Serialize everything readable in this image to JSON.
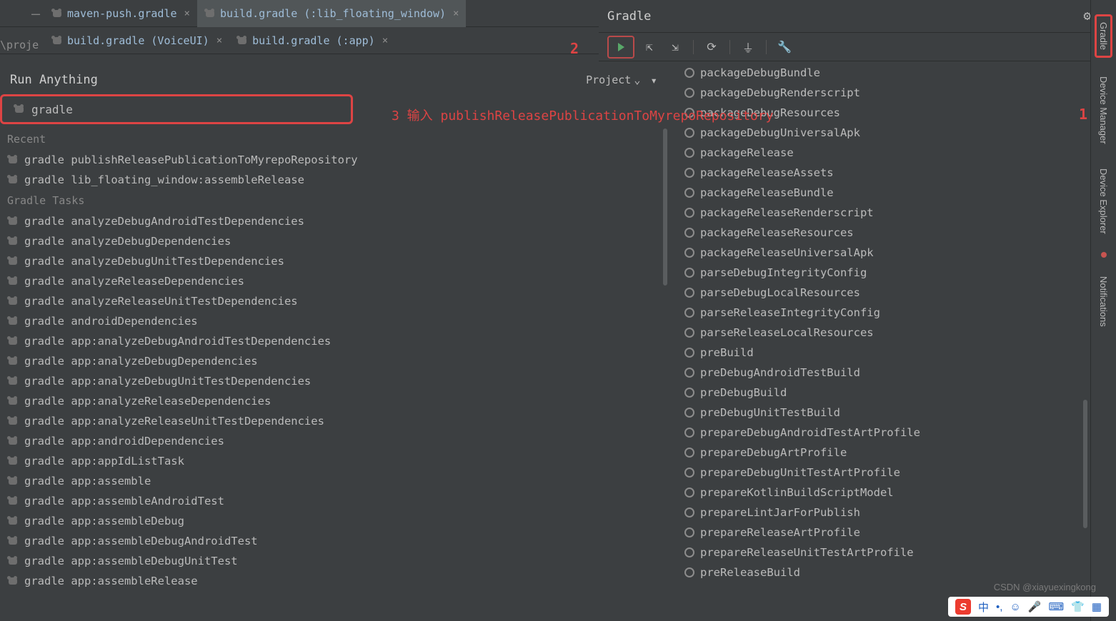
{
  "tabs_row1": [
    {
      "label": "maven-push.gradle",
      "active": false
    },
    {
      "label": "build.gradle (:lib_floating_window)",
      "active": true
    }
  ],
  "tabs_row2": [
    {
      "label": "build.gradle (VoiceUI)",
      "active": false
    },
    {
      "label": "build.gradle (:app)",
      "active": false
    }
  ],
  "breadcrumb_prefix": "\\proje",
  "gradle_panel": {
    "title": "Gradle",
    "toolbar": [
      "run",
      "expand",
      "collapse",
      "refresh",
      "offline",
      "settings"
    ]
  },
  "run_anything": {
    "title": "Run Anything",
    "scope_label": "Project",
    "input_value": "gradle",
    "sections": {
      "recent_label": "Recent",
      "recent": [
        "gradle publishReleasePublicationToMyrepoRepository",
        "gradle lib_floating_window:assembleRelease"
      ],
      "tasks_label": "Gradle Tasks",
      "tasks": [
        "gradle analyzeDebugAndroidTestDependencies",
        "gradle analyzeDebugDependencies",
        "gradle analyzeDebugUnitTestDependencies",
        "gradle analyzeReleaseDependencies",
        "gradle analyzeReleaseUnitTestDependencies",
        "gradle androidDependencies",
        "gradle app:analyzeDebugAndroidTestDependencies",
        "gradle app:analyzeDebugDependencies",
        "gradle app:analyzeDebugUnitTestDependencies",
        "gradle app:analyzeReleaseDependencies",
        "gradle app:analyzeReleaseUnitTestDependencies",
        "gradle app:androidDependencies",
        "gradle app:appIdListTask",
        "gradle app:assemble",
        "gradle app:assembleAndroidTest",
        "gradle app:assembleDebug",
        "gradle app:assembleDebugAndroidTest",
        "gradle app:assembleDebugUnitTest",
        "gradle app:assembleRelease"
      ]
    }
  },
  "gradle_tasks": [
    "packageDebugBundle",
    "packageDebugRenderscript",
    "packageDebugResources",
    "packageDebugUniversalApk",
    "packageRelease",
    "packageReleaseAssets",
    "packageReleaseBundle",
    "packageReleaseRenderscript",
    "packageReleaseResources",
    "packageReleaseUniversalApk",
    "parseDebugIntegrityConfig",
    "parseDebugLocalResources",
    "parseReleaseIntegrityConfig",
    "parseReleaseLocalResources",
    "preBuild",
    "preDebugAndroidTestBuild",
    "preDebugBuild",
    "preDebugUnitTestBuild",
    "prepareDebugAndroidTestArtProfile",
    "prepareDebugArtProfile",
    "prepareDebugUnitTestArtProfile",
    "prepareKotlinBuildScriptModel",
    "prepareLintJarForPublish",
    "prepareReleaseArtProfile",
    "prepareReleaseUnitTestArtProfile",
    "preReleaseBuild"
  ],
  "callouts": {
    "c1": "1",
    "c2": "2",
    "c3": "3 输入 publishReleasePublicationToMyrepoRepository"
  },
  "right_rail": [
    "Gradle",
    "Device Manager",
    "Device Explorer",
    "Notifications"
  ],
  "watermark": "CSDN @xiayuexingkong",
  "ime": {
    "lang": "中"
  }
}
